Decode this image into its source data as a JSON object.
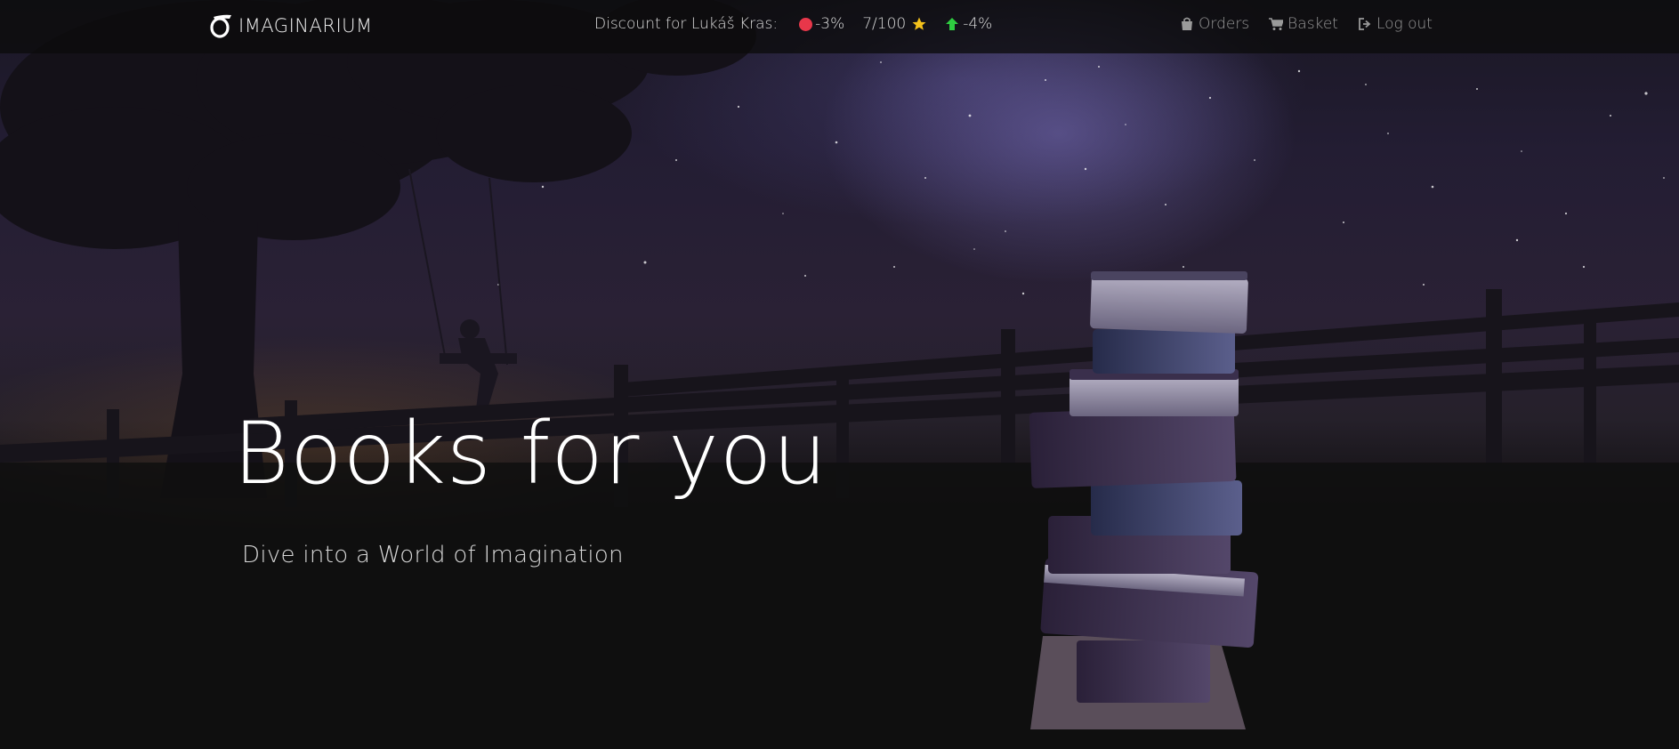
{
  "brand": {
    "name": "IMAGINARIUM"
  },
  "discount": {
    "label": "Discount for Lukáš Kras:",
    "penalty": "-3%",
    "rating": "7/100",
    "bonus": "-4%",
    "penalty_color": "#e8374a",
    "rating_color": "#f3c11b",
    "bonus_color": "#2ecc40"
  },
  "nav": {
    "orders": "Orders",
    "basket": "Basket",
    "logout": "Log out"
  },
  "icons": {
    "brand": "brand-logo-icon",
    "penalty": "red-circle-icon",
    "rating": "star-icon",
    "bonus": "arrow-up-icon",
    "orders": "shopping-bag-icon",
    "basket": "shopping-cart-icon",
    "logout": "sign-out-icon"
  },
  "hero": {
    "title": "Books for you",
    "subtitle": "Dive into a World of Imagination"
  }
}
